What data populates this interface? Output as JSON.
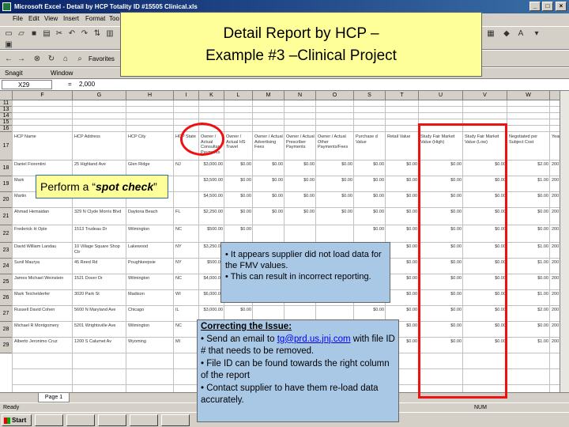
{
  "window": {
    "title": "Microsoft Excel - Detail by HCP Totality ID #15505 Clinical.xls",
    "min": "_",
    "max": "□",
    "close": "×"
  },
  "menu": [
    "File",
    "Edit",
    "View",
    "Insert",
    "Format",
    "Too"
  ],
  "toolbar3": {
    "prefix": "Snagit",
    "field": "Window"
  },
  "favorites_label": "Favorites",
  "formula": {
    "namebox": "X29",
    "eq": "=",
    "value": "2,000"
  },
  "columns": [
    "F",
    "G",
    "H",
    "I",
    "K",
    "L",
    "M",
    "N",
    "O",
    "S",
    "T",
    "U",
    "V",
    "W"
  ],
  "row_numbers": [
    "11",
    "13",
    "14",
    "15",
    "16",
    "17",
    "18",
    "19",
    "20",
    "21",
    "22",
    "23",
    "24",
    "25",
    "26",
    "27",
    "28",
    "29"
  ],
  "headers": {
    "hcp_name": "HCP Name",
    "hcp_address": "HCP Address",
    "hcp_city": "HCP City",
    "hcp_state": "HCP State",
    "k": "Owner / Actual Consultant Payments",
    "l": "Owner / Actual HS Travel",
    "m": "Owner / Actual Advertising Fees",
    "n": "Owner / Actual Prescriber Payments",
    "o": "Owner / Actual Other Payments/Fees",
    "s": "Purchase d Value",
    "t": "Retail Value",
    "u": "Study Fair Market Value (High)",
    "v": "Study Fair Market Value (Low)",
    "w": "Negotiated per Subject Cost",
    "x": "Year"
  },
  "rows": [
    {
      "name": "Daniel Fiorentini",
      "addr": "25 Highland Ave",
      "city": "Glen Ridge",
      "state": "NJ",
      "k": "$3,000.00",
      "l": "$0.00",
      "m": "$0.00",
      "n": "$0.00",
      "o": "$0.00",
      "s": "$0.00",
      "t": "$0.00",
      "u": "$0.00",
      "v": "$0.00",
      "w": "$2.00",
      "x": "200"
    },
    {
      "name": "Mark",
      "addr": "",
      "city": "",
      "state": "",
      "k": "$3,500.00",
      "l": "$0.00",
      "m": "$0.00",
      "n": "$0.00",
      "o": "$0.00",
      "s": "$0.00",
      "t": "$0.00",
      "u": "$0.00",
      "v": "$0.00",
      "w": "$1.00",
      "x": "200"
    },
    {
      "name": "Martin",
      "addr": "",
      "city": "",
      "state": "",
      "k": "$4,500.00",
      "l": "$0.00",
      "m": "$0.00",
      "n": "$0.00",
      "o": "$0.00",
      "s": "$0.00",
      "t": "$0.00",
      "u": "$0.00",
      "v": "$0.00",
      "w": "$0.00",
      "x": "200"
    },
    {
      "name": "Ahmad Hemaidan",
      "addr": "329 N Clyde Morris Blvd",
      "city": "Daytona Beach",
      "state": "FL",
      "k": "$2,250.00",
      "l": "$0.00",
      "m": "$0.00",
      "n": "$0.00",
      "o": "$0.00",
      "s": "$0.00",
      "t": "$0.00",
      "u": "$0.00",
      "v": "$0.00",
      "w": "$0.00",
      "x": "200"
    },
    {
      "name": "Frederick H Ople",
      "addr": "1513 Trudeau Dr",
      "city": "Wilmington",
      "state": "NC",
      "k": "$500.00",
      "l": "$0.00",
      "m": "",
      "n": "",
      "o": "",
      "s": "$0.00",
      "t": "$0.00",
      "u": "$0.00",
      "v": "$0.00",
      "w": "$0.00",
      "x": "200"
    },
    {
      "name": "David William Landau",
      "addr": "10 Village Square Shop Ctr",
      "city": "Lakewood",
      "state": "NY",
      "k": "$3,250.00",
      "l": "",
      "m": "",
      "n": "",
      "o": "",
      "s": "$0.00",
      "t": "$0.00",
      "u": "$0.00",
      "v": "$0.00",
      "w": "$1.00",
      "x": "200"
    },
    {
      "name": "Sunil Maurya",
      "addr": "45 Reed Rd",
      "city": "Poughkeepsie",
      "state": "NY",
      "k": "$500.00",
      "l": "",
      "m": "",
      "n": "",
      "o": "",
      "s": "$0.00",
      "t": "$0.00",
      "u": "$0.00",
      "v": "$0.00",
      "w": "$1.00",
      "x": "200"
    },
    {
      "name": "James Michael Weinstein",
      "addr": "1521 Dover Dr",
      "city": "Wilmington",
      "state": "NC",
      "k": "$4,000.00",
      "l": "",
      "m": "",
      "n": "",
      "o": "",
      "s": "$0.00",
      "t": "$0.00",
      "u": "$0.00",
      "v": "$0.00",
      "w": "$0.00",
      "x": "200"
    },
    {
      "name": "Mark Teichelderfer",
      "addr": "3020 Park St",
      "city": "Madison",
      "state": "WI",
      "k": "$6,000.00",
      "l": "$0.00",
      "m": "",
      "n": "",
      "o": "",
      "s": "$0.00",
      "t": "$0.00",
      "u": "$0.00",
      "v": "$0.00",
      "w": "$1.00",
      "x": "200"
    },
    {
      "name": "Russell David Cohen",
      "addr": "5600 N Maryland Ave",
      "city": "Chicago",
      "state": "IL",
      "k": "$3,000.00",
      "l": "$0.00",
      "m": "",
      "n": "",
      "o": "",
      "s": "$0.00",
      "t": "$0.00",
      "u": "$0.00",
      "v": "$0.00",
      "w": "$2.00",
      "x": "200"
    },
    {
      "name": "Michael R Montgomery",
      "addr": "5201 Wrightsville Ave",
      "city": "Wilmington",
      "state": "NC",
      "k": "$7,000.00",
      "l": "$0.00",
      "m": "",
      "n": "",
      "o": "",
      "s": "$0.00",
      "t": "$0.00",
      "u": "$0.00",
      "v": "$0.00",
      "w": "$0.00",
      "x": "200"
    },
    {
      "name": "Alberto Jeronimo Cruz",
      "addr": "1200 S Calumet Av",
      "city": "Wyoming",
      "state": "MI",
      "k": "$2,000.00",
      "l": "$0.00",
      "m": "",
      "n": "",
      "o": "",
      "s": "$0.00",
      "t": "$0.00",
      "u": "$0.00",
      "v": "$0.00",
      "w": "$1.00",
      "x": "200"
    }
  ],
  "sheet_tab": "Page 1",
  "status": {
    "left": "Ready",
    "num": "NUM"
  },
  "taskbar": {
    "start": "Start"
  },
  "overlay": {
    "title_line1": "Detail Report by HCP –",
    "title_line2": "Example #3 –Clinical Project",
    "spot_check_prefix": "Perform a “",
    "spot_check_emph": "spot check",
    "spot_check_suffix": "”",
    "supplier_lines": [
      "• It appears supplier did not load data for the FMV values.",
      "• This can result in incorrect reporting."
    ],
    "issue_title": "Correcting the Issue:",
    "issue_line1_pre": "• Send an email to ",
    "issue_email": "tg@prd.us.jnj.com",
    "issue_line1_post": " with file ID # that  needs to be removed.",
    "issue_line2": "• File ID can be found towards the right column of the report",
    "issue_line3": "• Contact supplier to have them re-load data accurately."
  },
  "colors": {
    "highlight_red": "#ee1111",
    "callout_yellow": "#ffff99",
    "callout_blue": "#a9c8e6",
    "titlebar_blue": "#0a246a"
  }
}
